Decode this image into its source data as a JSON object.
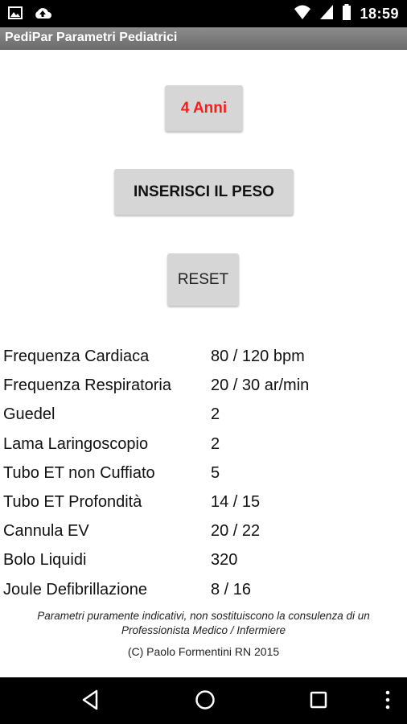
{
  "status_bar": {
    "time": "18:59"
  },
  "app": {
    "title": "PediPar Parametri Pediatrici"
  },
  "buttons": {
    "age": "4 Anni",
    "weight": "INSERISCI IL PESO",
    "reset": "RESET"
  },
  "parameters": [
    {
      "label": "Frequenza Cardiaca",
      "value": "80 / 120 bpm"
    },
    {
      "label": "Frequenza Respiratoria",
      "value": "20 / 30 ar/min"
    },
    {
      "label": "Guedel",
      "value": "2"
    },
    {
      "label": "Lama Laringoscopio",
      "value": "2"
    },
    {
      "label": "Tubo ET non Cuffiato",
      "value": "5"
    },
    {
      "label": "Tubo ET Profondità",
      "value": "14 / 15"
    },
    {
      "label": "Cannula EV",
      "value": "20 / 22"
    },
    {
      "label": "Bolo Liquidi",
      "value": "320"
    },
    {
      "label": "Joule Defibrillazione",
      "value": "8 / 16"
    }
  ],
  "footer": {
    "disclaimer_line1": "Parametri puramente indicativi, non sostituiscono la consulenza di un",
    "disclaimer_line2": "Professionista Medico / Infermiere",
    "copyright": "(C) Paolo Formentini RN 2015"
  },
  "colors": {
    "age_text": "#ff1a1a",
    "button_bg": "#d6d6d6",
    "title_bar": "#7a7a7a"
  },
  "icons": [
    "image-icon",
    "cloud-upload-icon",
    "wifi-icon",
    "signal-icon",
    "battery-icon",
    "back-icon",
    "home-icon",
    "recents-icon",
    "overflow-menu-icon"
  ]
}
